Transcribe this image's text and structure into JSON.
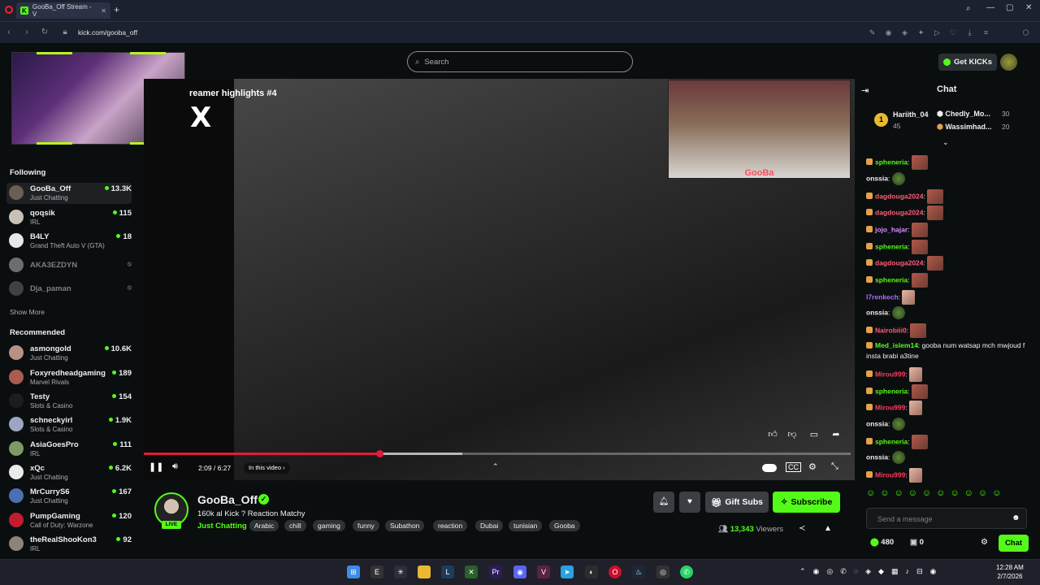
{
  "browser": {
    "tab_title": "GooBa_Off Stream - V",
    "url": "kick.com/gooba_off"
  },
  "header": {
    "search_placeholder": "Search",
    "get_kicks_label": "Get KICKs"
  },
  "sidebar": {
    "following_title": "Following",
    "following": [
      {
        "name": "GooBa_Off",
        "category": "Just Chatting",
        "viewers": "13.3K",
        "live": true
      },
      {
        "name": "qoqsik",
        "category": "IRL",
        "viewers": "115",
        "live": true
      },
      {
        "name": "B4LY",
        "category": "Grand Theft Auto V (GTA)",
        "viewers": "18",
        "live": true
      },
      {
        "name": "AKA3EZDYN",
        "category": "",
        "viewers": "",
        "live": false
      },
      {
        "name": "Dja_paman",
        "category": "",
        "viewers": "",
        "live": false
      }
    ],
    "show_more_label": "Show More",
    "recommended_title": "Recommended",
    "recommended": [
      {
        "name": "asmongold",
        "category": "Just Chatting",
        "viewers": "10.6K"
      },
      {
        "name": "Foxyredheadgaming",
        "category": "Marvel Rivals",
        "viewers": "189"
      },
      {
        "name": "Testy",
        "category": "Slots & Casino",
        "viewers": "154"
      },
      {
        "name": "schneckyirl",
        "category": "Slots & Casino",
        "viewers": "1.9K"
      },
      {
        "name": "AsiaGoesPro",
        "category": "IRL",
        "viewers": "111"
      },
      {
        "name": "xQc",
        "category": "Just Chatting",
        "viewers": "6.2K"
      },
      {
        "name": "MrCurryS6",
        "category": "Just Chatting",
        "viewers": "167"
      },
      {
        "name": "PumpGaming",
        "category": "Call of Duty: Warzone",
        "viewers": "120"
      },
      {
        "name": "theRealShooKon3",
        "category": "IRL",
        "viewers": "92"
      }
    ]
  },
  "video": {
    "overlay_title": "reamer highlights #4",
    "overlay_logo": "X",
    "pip_label": "GooBa",
    "time": "2:09 / 6:27",
    "progress_fraction": 0.333,
    "buffered_fraction": 0.45,
    "in_this_video_label": "In this video"
  },
  "stream": {
    "channel": "GooBa_Off",
    "live_badge": "LIVE",
    "title": "160k al Kick ? Reaction Matchy",
    "category": "Just Chatting",
    "tags": [
      "Arabic",
      "chill",
      "gaming",
      "funny",
      "Subathon",
      "reaction",
      "Dubai",
      "tunisian",
      "Gooba"
    ],
    "gift_subs_label": "Gift Subs",
    "subscribe_label": "Subscribe",
    "viewers": "13,343",
    "viewers_label": "Viewers"
  },
  "chat": {
    "title": "Chat",
    "leaderboard": [
      {
        "rank": "1",
        "name": "Hariith_04",
        "count": "45"
      },
      {
        "name": "Chedly_Mo...",
        "count": "30"
      },
      {
        "name": "Wassimhad...",
        "count": "20"
      }
    ],
    "messages": [
      {
        "user": "spheneria",
        "color": "#53fc18",
        "text": ""
      },
      {
        "user": "onssia",
        "color": "#efeff1",
        "text": ""
      },
      {
        "user": "dagdouga2024",
        "color": "#ff5c7a",
        "text": ""
      },
      {
        "user": "dagdouga2024",
        "color": "#ff5c7a",
        "text": ""
      },
      {
        "user": "jojo_hajar",
        "color": "#d98cff",
        "text": ""
      },
      {
        "user": "spheneria",
        "color": "#53fc18",
        "text": ""
      },
      {
        "user": "dagdouga2024",
        "color": "#ff5c7a",
        "text": ""
      },
      {
        "user": "spheneria",
        "color": "#53fc18",
        "text": ""
      },
      {
        "user": "l7renkech",
        "color": "#b36cff",
        "text": ""
      },
      {
        "user": "onssia",
        "color": "#efeff1",
        "text": ""
      },
      {
        "user": "Nairobiii0",
        "color": "#ff5c7a",
        "text": ""
      },
      {
        "user": "Med_islem14",
        "color": "#53fc18",
        "text": "gooba num watsap mch mwjoud f insta brabi a3tine"
      },
      {
        "user": "Mirou999",
        "color": "#ff3b5c",
        "text": ""
      },
      {
        "user": "spheneria",
        "color": "#53fc18",
        "text": ""
      },
      {
        "user": "Mirou999",
        "color": "#ff3b5c",
        "text": ""
      },
      {
        "user": "onssia",
        "color": "#efeff1",
        "text": ""
      },
      {
        "user": "spheneria",
        "color": "#53fc18",
        "text": ""
      },
      {
        "user": "onssia",
        "color": "#efeff1",
        "text": ""
      },
      {
        "user": "Mirou999",
        "color": "#ff3b5c",
        "text": ""
      }
    ],
    "input_placeholder": "Send a message",
    "kicks_balance": "480",
    "other_count": "0",
    "send_label": "Chat"
  },
  "taskbar": {
    "time": "12:28 AM",
    "date": "2/7/2026"
  }
}
